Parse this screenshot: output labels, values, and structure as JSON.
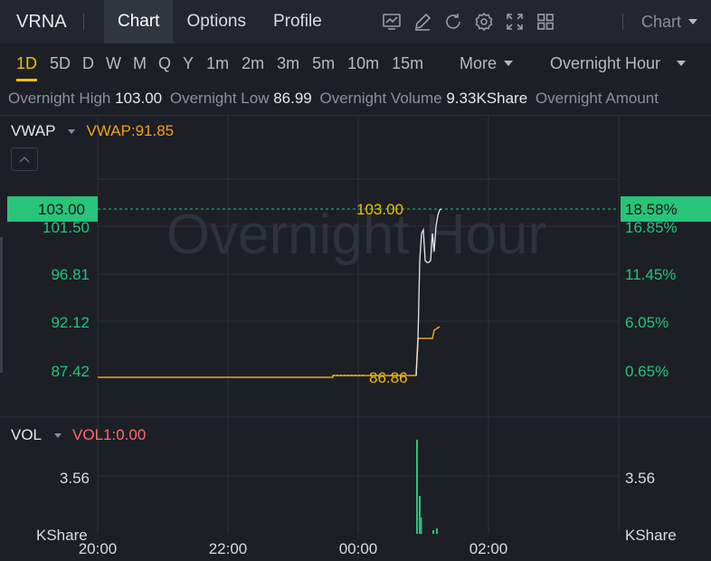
{
  "header": {
    "ticker": "VRNA",
    "tabs": [
      {
        "label": "Chart",
        "active": true
      },
      {
        "label": "Options",
        "active": false
      },
      {
        "label": "Profile",
        "active": false
      }
    ],
    "tool_icons": [
      "chart-analysis-icon",
      "draw-pen-icon",
      "refresh-icon",
      "settings-gear-icon",
      "fullscreen-icon",
      "layout-grid-icon"
    ],
    "chart_dropdown": "Chart"
  },
  "periods": [
    "1D",
    "5D",
    "D",
    "W",
    "M",
    "Q",
    "Y",
    "1m",
    "2m",
    "3m",
    "5m",
    "10m",
    "15m"
  ],
  "active_period": "1D",
  "more_label": "More",
  "session_label": "Overnight Hour",
  "info": {
    "high_label": "Overnight High",
    "high_value": "103.00",
    "low_label": "Overnight Low",
    "low_value": "86.99",
    "volume_label": "Overnight Volume",
    "volume_value": "9.33KShare",
    "amount_label": "Overnight Amount"
  },
  "price_panel": {
    "indicator": "VWAP",
    "indicator_value": "VWAP:91.85",
    "watermark": "Overnight Hour",
    "current_price_tag": "103.00",
    "current_pct_tag": "18.58%",
    "y_left_ticks": [
      "101.50",
      "96.81",
      "92.12",
      "87.42"
    ],
    "y_right_ticks": [
      "16.85%",
      "11.45%",
      "6.05%",
      "0.65%"
    ],
    "high_label": "103.00",
    "low_label": "86.86"
  },
  "volume_panel": {
    "indicator": "VOL",
    "indicator_value": "VOL1:0.00",
    "left_tick": "3.56",
    "right_tick": "3.56",
    "left_unit": "KShare",
    "right_unit": "KShare"
  },
  "x_ticks": [
    "20:00",
    "22:00",
    "00:00",
    "02:00"
  ],
  "colors": {
    "accent": "#f0c000",
    "up_green": "#27c47a",
    "vwap_orange": "#f0a020",
    "vol_red": "#ff6b6b",
    "price_line": "#e6e7ea"
  },
  "chart_data": {
    "type": "line",
    "y_range": [
      85.5,
      104.3
    ],
    "series": [
      {
        "name": "VWAP",
        "values": [
          86.86,
          86.86,
          86.86,
          86.99,
          90.9,
          91.2,
          91.85
        ]
      }
    ],
    "volume": {
      "peak": "3.56"
    }
  }
}
